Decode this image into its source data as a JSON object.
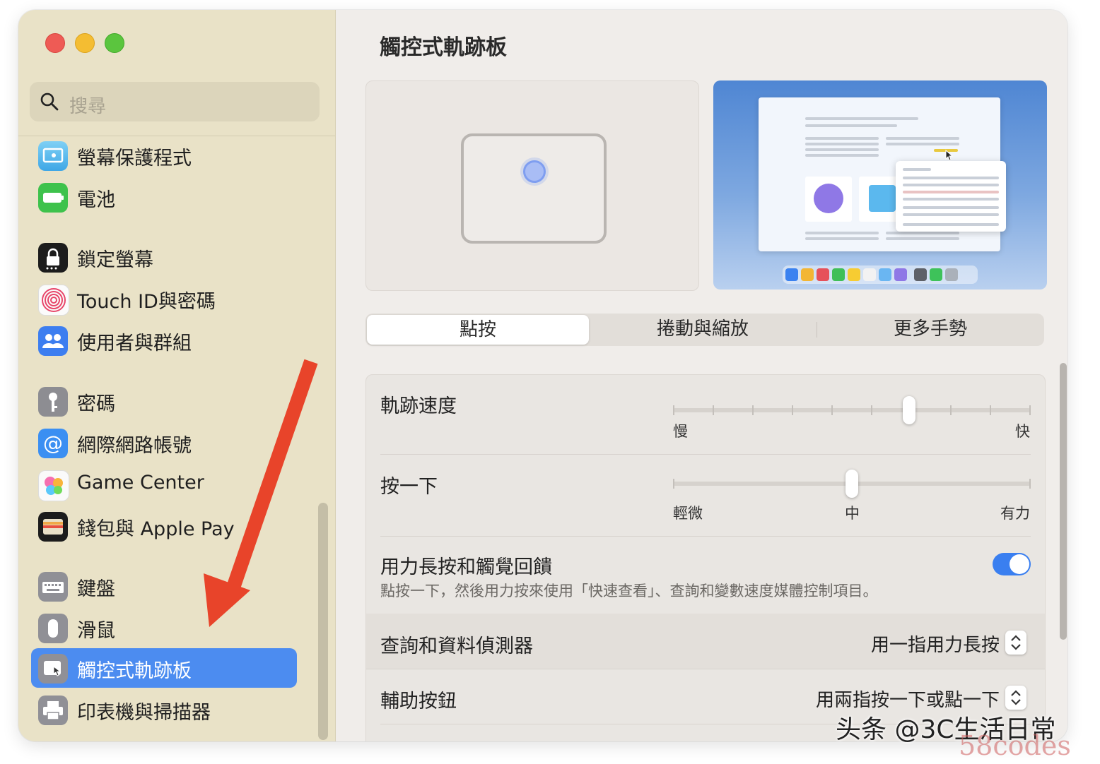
{
  "sidebar": {
    "search_placeholder": "搜尋",
    "items": [
      {
        "label": "螢幕保護程式",
        "icon": "screensaver-icon"
      },
      {
        "label": "電池",
        "icon": "battery-icon"
      },
      {
        "label": "鎖定螢幕",
        "icon": "lock-screen-icon"
      },
      {
        "label": "Touch ID與密碼",
        "icon": "fingerprint-icon"
      },
      {
        "label": "使用者與群組",
        "icon": "users-icon"
      },
      {
        "label": "密碼",
        "icon": "key-icon"
      },
      {
        "label": "網際網路帳號",
        "icon": "at-sign-icon"
      },
      {
        "label": "Game Center",
        "icon": "game-center-icon"
      },
      {
        "label": "錢包與 Apple Pay",
        "icon": "wallet-icon"
      },
      {
        "label": "鍵盤",
        "icon": "keyboard-icon"
      },
      {
        "label": "滑鼠",
        "icon": "mouse-icon"
      },
      {
        "label": "觸控式軌跡板",
        "icon": "trackpad-icon",
        "selected": true
      },
      {
        "label": "印表機與掃描器",
        "icon": "printer-icon"
      }
    ]
  },
  "main": {
    "title": "觸控式軌跡板",
    "tabs": [
      {
        "label": "點按",
        "active": true
      },
      {
        "label": "捲動與縮放",
        "active": false
      },
      {
        "label": "更多手勢",
        "active": false
      }
    ],
    "tracking_speed": {
      "label": "軌跡速度",
      "min_label": "慢",
      "max_label": "快",
      "ticks": 10,
      "value_fraction": 0.66
    },
    "click": {
      "label": "按一下",
      "left_label": "輕微",
      "mid_label": "中",
      "right_label": "有力",
      "value_fraction": 0.5
    },
    "force_click": {
      "label": "用力長按和觸覺回饋",
      "description": "點按一下，然後用力按來使用「快速查看」、查詢和變數速度媒體控制項目。",
      "enabled": true
    },
    "lookup": {
      "label": "查詢和資料偵測器",
      "value": "用一指用力長按"
    },
    "secondary_click": {
      "label": "輔助按鈕",
      "value": "用兩指按一下或點一下"
    }
  },
  "colors": {
    "sidebar_bg": "#e9e2c7",
    "selection": "#4c8cf0",
    "toggle_on": "#3a7ff0",
    "annotation_arrow": "#e8442a"
  },
  "watermark": {
    "text": "头条 @3C生活日常",
    "secondary": "58codes"
  }
}
